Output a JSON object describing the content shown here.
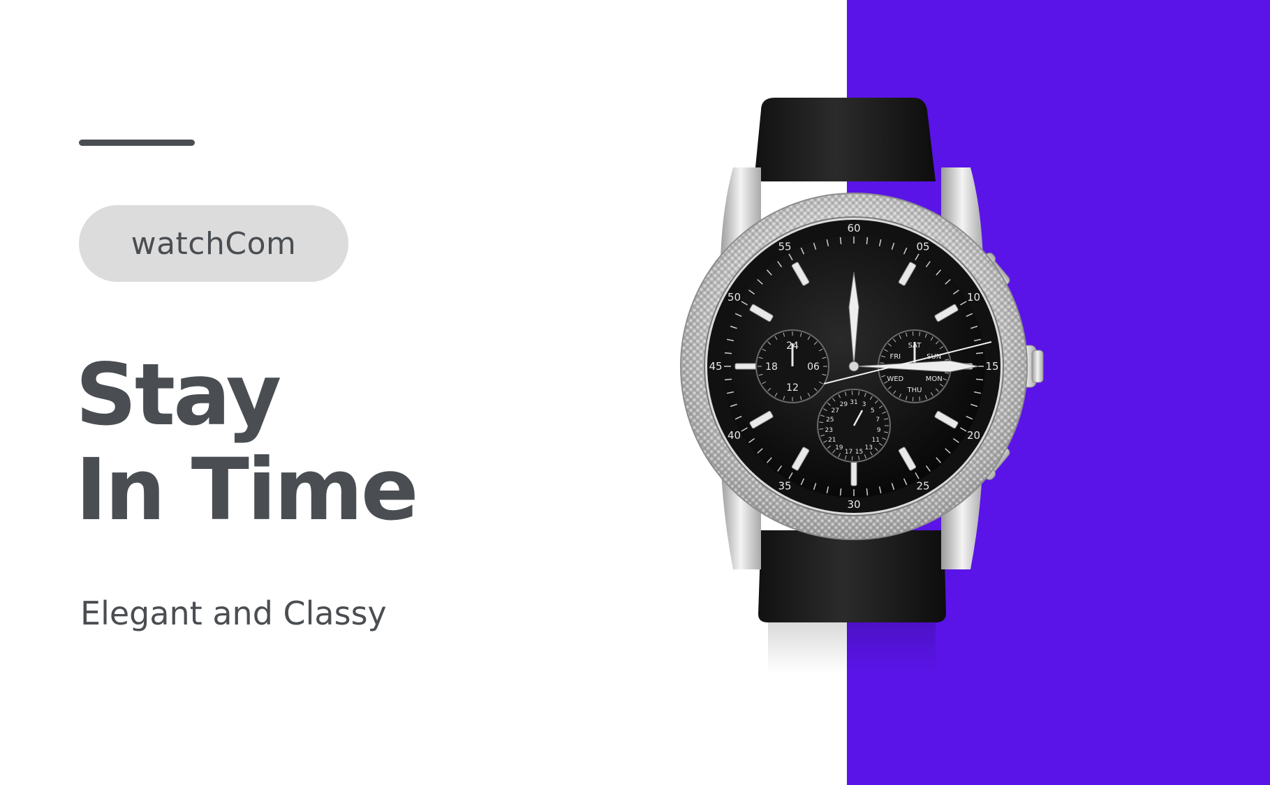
{
  "brand": {
    "name": "watchCom"
  },
  "hero": {
    "headline_line1": "Stay",
    "headline_line2": "In Time",
    "tagline": "Elegant and Classy"
  },
  "colors": {
    "accent_panel": "#5a14e8",
    "text": "#4a4e52",
    "pill_background": "#dcdcdc",
    "background": "#ffffff"
  },
  "watch": {
    "bezel_numbers": [
      "60",
      "05",
      "10",
      "15",
      "20",
      "25",
      "30",
      "35",
      "40",
      "45",
      "50",
      "55"
    ],
    "left_subdial_numbers": [
      "24",
      "06",
      "12",
      "18"
    ],
    "right_subdial_days": [
      "SAT",
      "SUN",
      "MON",
      "THU",
      "WED",
      "FRI"
    ],
    "bottom_subdial_numbers": [
      "31",
      "3",
      "5",
      "7",
      "9",
      "11",
      "13",
      "15",
      "17",
      "19",
      "21",
      "23",
      "25",
      "27",
      "29"
    ]
  }
}
